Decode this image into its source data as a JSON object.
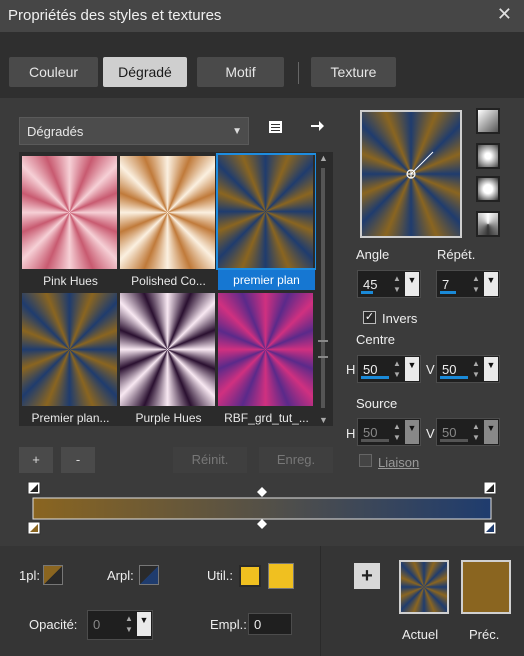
{
  "window": {
    "title": "Propriétés des styles et textures",
    "close": "✕"
  },
  "tabs": [
    "Couleur",
    "Dégradé",
    "Motif",
    "Texture"
  ],
  "gallery": {
    "dropdown": "Dégradés",
    "items": [
      "Pink Hues",
      "Polished Co...",
      "premier plan",
      "Premier plan...",
      "Purple Hues",
      "RBF_grd_tut_..."
    ],
    "selected_index": 2
  },
  "buttons": {
    "add": "+",
    "remove": "-",
    "reset": "Réinit.",
    "save": "Enreg."
  },
  "params": {
    "angle_label": "Angle",
    "angle": "45",
    "repeat_label": "Répét.",
    "repeat": "7",
    "invert_label": "Invers",
    "invert_checked": "✓",
    "centre_label": "Centre",
    "centre_h": "50",
    "centre_v": "50",
    "source_label": "Source",
    "source_h": "50",
    "source_v": "50",
    "link_label": "Liaison",
    "h": "H",
    "v": "V"
  },
  "bottom": {
    "fg_label": "1pl:",
    "bg_label": "Arpl:",
    "use_label": "Util.:",
    "opacity_label": "Opacité:",
    "opacity": "0",
    "location_label": "Empl.:",
    "location": "0",
    "current_label": "Actuel",
    "previous_label": "Préc."
  },
  "colors": {
    "gold": "#8a6520",
    "navy": "#1f3c6e",
    "accent": "#1a8ad8",
    "yellow": "#f0c020"
  }
}
